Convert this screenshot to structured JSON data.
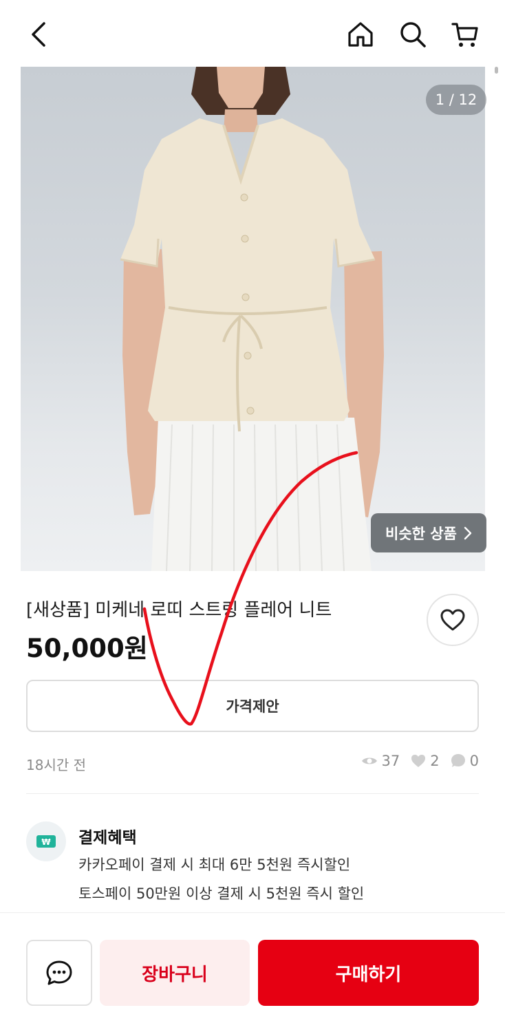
{
  "header": {
    "back_icon": "chevron-left-icon",
    "home_icon": "home-icon",
    "search_icon": "search-icon",
    "cart_icon": "cart-icon"
  },
  "gallery": {
    "counter": "1 / 12",
    "similar_label": "비슷한 상품",
    "similar_icon": "chevron-right-icon"
  },
  "product": {
    "title": "[새상품] 미케네 로띠 스트링 플레어 니트",
    "price": "50,000원",
    "like_icon": "heart-outline-icon",
    "offer_label": "가격제안",
    "posted": "18시간 전",
    "views": "37",
    "likes": "2",
    "chats": "0"
  },
  "benefit": {
    "icon": "won-card-icon",
    "title": "결제혜택",
    "lines": [
      "카카오페이 결제 시 최대 6만 5천원 즉시할인",
      "토스페이 50만원 이상 결제 시 5천원 즉시 할인"
    ]
  },
  "actions": {
    "chat_icon": "chat-bubble-icon",
    "cart_label": "장바구니",
    "buy_label": "구매하기"
  },
  "colors": {
    "accent": "#e60012",
    "cart_bg": "#fdeeee",
    "annotation": "#e8101c"
  }
}
